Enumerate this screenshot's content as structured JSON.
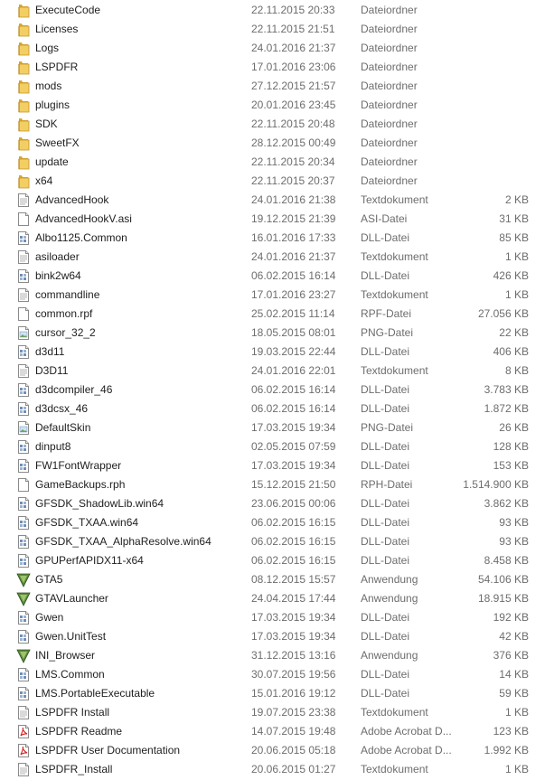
{
  "files": [
    {
      "name": "ExecuteCode",
      "date": "22.11.2015 20:33",
      "type": "Dateiordner",
      "size": "",
      "icon": "folder-icon"
    },
    {
      "name": "Licenses",
      "date": "22.11.2015 21:51",
      "type": "Dateiordner",
      "size": "",
      "icon": "folder-icon"
    },
    {
      "name": "Logs",
      "date": "24.01.2016 21:37",
      "type": "Dateiordner",
      "size": "",
      "icon": "folder-icon"
    },
    {
      "name": "LSPDFR",
      "date": "17.01.2016 23:06",
      "type": "Dateiordner",
      "size": "",
      "icon": "folder-icon"
    },
    {
      "name": "mods",
      "date": "27.12.2015 21:57",
      "type": "Dateiordner",
      "size": "",
      "icon": "folder-icon"
    },
    {
      "name": "plugins",
      "date": "20.01.2016 23:45",
      "type": "Dateiordner",
      "size": "",
      "icon": "folder-icon"
    },
    {
      "name": "SDK",
      "date": "22.11.2015 20:48",
      "type": "Dateiordner",
      "size": "",
      "icon": "folder-icon"
    },
    {
      "name": "SweetFX",
      "date": "28.12.2015 00:49",
      "type": "Dateiordner",
      "size": "",
      "icon": "folder-icon"
    },
    {
      "name": "update",
      "date": "22.11.2015 20:34",
      "type": "Dateiordner",
      "size": "",
      "icon": "folder-icon"
    },
    {
      "name": "x64",
      "date": "22.11.2015 20:37",
      "type": "Dateiordner",
      "size": "",
      "icon": "folder-icon"
    },
    {
      "name": "AdvancedHook",
      "date": "24.01.2016 21:38",
      "type": "Textdokument",
      "size": "2 KB",
      "icon": "text-file-icon"
    },
    {
      "name": "AdvancedHookV.asi",
      "date": "19.12.2015 21:39",
      "type": "ASI-Datei",
      "size": "31 KB",
      "icon": "blank-file-icon"
    },
    {
      "name": "Albo1125.Common",
      "date": "16.01.2016 17:33",
      "type": "DLL-Datei",
      "size": "85 KB",
      "icon": "dll-file-icon"
    },
    {
      "name": "asiloader",
      "date": "24.01.2016 21:37",
      "type": "Textdokument",
      "size": "1 KB",
      "icon": "text-file-icon"
    },
    {
      "name": "bink2w64",
      "date": "06.02.2015 16:14",
      "type": "DLL-Datei",
      "size": "426 KB",
      "icon": "dll-file-icon"
    },
    {
      "name": "commandline",
      "date": "17.01.2016 23:27",
      "type": "Textdokument",
      "size": "1 KB",
      "icon": "text-file-icon"
    },
    {
      "name": "common.rpf",
      "date": "25.02.2015 11:14",
      "type": "RPF-Datei",
      "size": "27.056 KB",
      "icon": "blank-file-icon"
    },
    {
      "name": "cursor_32_2",
      "date": "18.05.2015 08:01",
      "type": "PNG-Datei",
      "size": "22 KB",
      "icon": "image-file-icon"
    },
    {
      "name": "d3d11",
      "date": "19.03.2015 22:44",
      "type": "DLL-Datei",
      "size": "406 KB",
      "icon": "dll-file-icon"
    },
    {
      "name": "D3D11",
      "date": "24.01.2016 22:01",
      "type": "Textdokument",
      "size": "8 KB",
      "icon": "text-file-icon"
    },
    {
      "name": "d3dcompiler_46",
      "date": "06.02.2015 16:14",
      "type": "DLL-Datei",
      "size": "3.783 KB",
      "icon": "dll-file-icon"
    },
    {
      "name": "d3dcsx_46",
      "date": "06.02.2015 16:14",
      "type": "DLL-Datei",
      "size": "1.872 KB",
      "icon": "dll-file-icon"
    },
    {
      "name": "DefaultSkin",
      "date": "17.03.2015 19:34",
      "type": "PNG-Datei",
      "size": "26 KB",
      "icon": "image-file-icon"
    },
    {
      "name": "dinput8",
      "date": "02.05.2015 07:59",
      "type": "DLL-Datei",
      "size": "128 KB",
      "icon": "dll-file-icon"
    },
    {
      "name": "FW1FontWrapper",
      "date": "17.03.2015 19:34",
      "type": "DLL-Datei",
      "size": "153 KB",
      "icon": "dll-file-icon"
    },
    {
      "name": "GameBackups.rph",
      "date": "15.12.2015 21:50",
      "type": "RPH-Datei",
      "size": "1.514.900 KB",
      "icon": "blank-file-icon"
    },
    {
      "name": "GFSDK_ShadowLib.win64",
      "date": "23.06.2015 00:06",
      "type": "DLL-Datei",
      "size": "3.862 KB",
      "icon": "dll-file-icon"
    },
    {
      "name": "GFSDK_TXAA.win64",
      "date": "06.02.2015 16:15",
      "type": "DLL-Datei",
      "size": "93 KB",
      "icon": "dll-file-icon"
    },
    {
      "name": "GFSDK_TXAA_AlphaResolve.win64",
      "date": "06.02.2015 16:15",
      "type": "DLL-Datei",
      "size": "93 KB",
      "icon": "dll-file-icon"
    },
    {
      "name": "GPUPerfAPIDX11-x64",
      "date": "06.02.2015 16:15",
      "type": "DLL-Datei",
      "size": "8.458 KB",
      "icon": "dll-file-icon"
    },
    {
      "name": "GTA5",
      "date": "08.12.2015 15:57",
      "type": "Anwendung",
      "size": "54.106 KB",
      "icon": "gta-app-icon"
    },
    {
      "name": "GTAVLauncher",
      "date": "24.04.2015 17:44",
      "type": "Anwendung",
      "size": "18.915 KB",
      "icon": "gta-app-icon"
    },
    {
      "name": "Gwen",
      "date": "17.03.2015 19:34",
      "type": "DLL-Datei",
      "size": "192 KB",
      "icon": "dll-file-icon"
    },
    {
      "name": "Gwen.UnitTest",
      "date": "17.03.2015 19:34",
      "type": "DLL-Datei",
      "size": "42 KB",
      "icon": "dll-file-icon"
    },
    {
      "name": "INI_Browser",
      "date": "31.12.2015 13:16",
      "type": "Anwendung",
      "size": "376 KB",
      "icon": "gta-app-icon"
    },
    {
      "name": "LMS.Common",
      "date": "30.07.2015 19:56",
      "type": "DLL-Datei",
      "size": "14 KB",
      "icon": "dll-file-icon"
    },
    {
      "name": "LMS.PortableExecutable",
      "date": "15.01.2016 19:12",
      "type": "DLL-Datei",
      "size": "59 KB",
      "icon": "dll-file-icon"
    },
    {
      "name": "LSPDFR Install",
      "date": "19.07.2015 23:38",
      "type": "Textdokument",
      "size": "1 KB",
      "icon": "text-file-icon"
    },
    {
      "name": "LSPDFR Readme",
      "date": "14.07.2015 19:48",
      "type": "Adobe Acrobat D...",
      "size": "123 KB",
      "icon": "pdf-file-icon"
    },
    {
      "name": "LSPDFR User Documentation",
      "date": "20.06.2015 05:18",
      "type": "Adobe Acrobat D...",
      "size": "1.992 KB",
      "icon": "pdf-file-icon"
    },
    {
      "name": "LSPDFR_Install",
      "date": "20.06.2015 01:27",
      "type": "Textdokument",
      "size": "1 KB",
      "icon": "text-file-icon"
    }
  ]
}
